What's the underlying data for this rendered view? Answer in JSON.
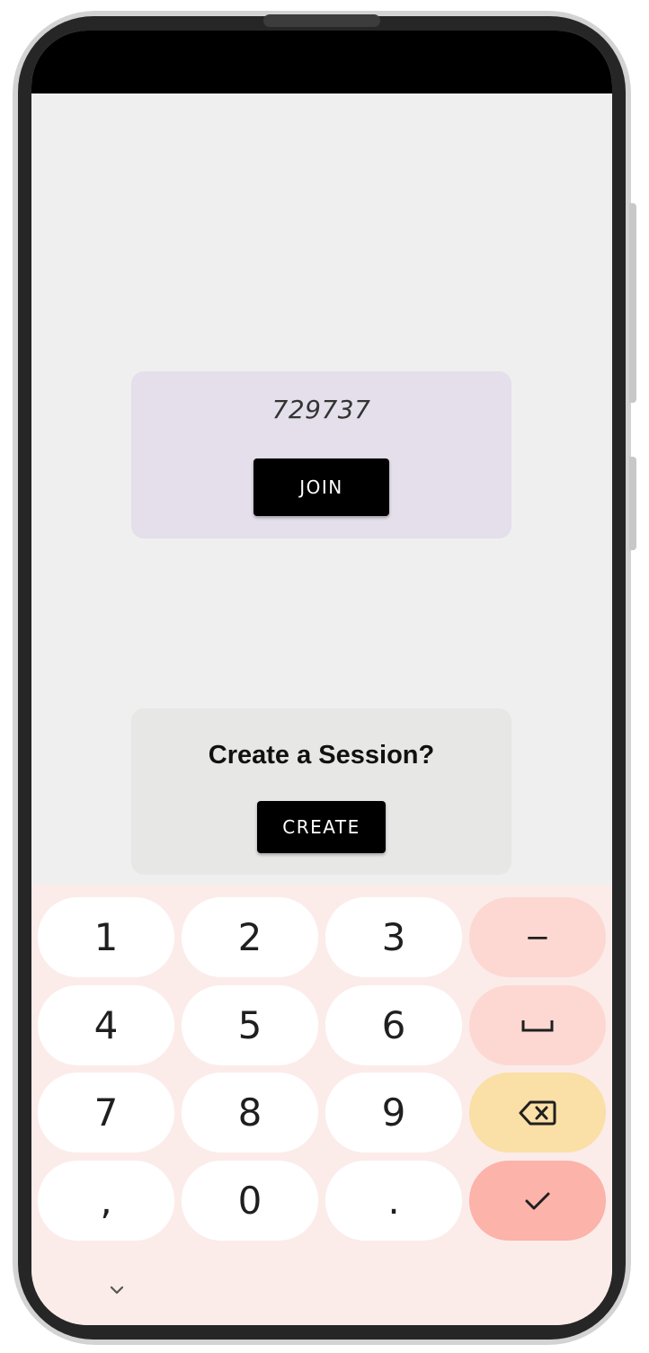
{
  "join_card": {
    "session_code": "729737",
    "join_label": "JOIN"
  },
  "create_card": {
    "title": "Create a Session?",
    "create_label": "CREATE"
  },
  "keyboard": {
    "row1": [
      "1",
      "2",
      "3",
      "−"
    ],
    "row2": [
      "4",
      "5",
      "6",
      "␣"
    ],
    "row3": [
      "7",
      "8",
      "9"
    ],
    "row4": [
      ",",
      "0",
      "."
    ],
    "icons": {
      "space": "space-icon",
      "backspace": "backspace-icon",
      "enter": "checkmark-icon",
      "hide": "chevron-down-icon"
    }
  },
  "colors": {
    "screen_bg": "#efefef",
    "join_card_bg": "#e4dfeb",
    "create_card_bg": "#e7e7e6",
    "button_bg": "#000000",
    "keyboard_bg": "#fbecea",
    "action_key": "#fdd8d2",
    "delete_key": "#fadfa6",
    "enter_key": "#fbb3aa"
  }
}
